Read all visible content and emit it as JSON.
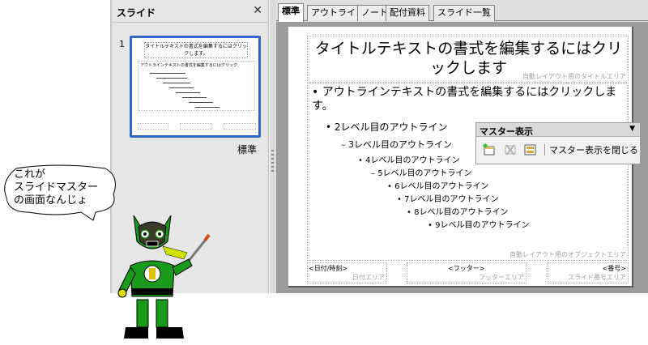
{
  "slides_pane": {
    "title": "スライド",
    "close_icon": "close-icon",
    "thumbnail_number": "1",
    "layout_name": "標準",
    "thumb_title": "タイトルテキストの書式を編集するにはクリックします。",
    "thumb_line": "アウトラインテキストの書式を編集するにはクリック"
  },
  "tabs": [
    "標準",
    "アウトライン",
    "ノート",
    "配付資料",
    "スライド一覧"
  ],
  "slide": {
    "title": "タイトルテキストの書式を編集するにはクリックします",
    "title_area_label": "自動レイアウト用のタイトルエリア",
    "outline": [
      "アウトラインテキストの書式を編集するにはクリックします。",
      "2レベル目のアウトライン",
      "3レベル目のアウトライン",
      "4レベル目のアウトライン",
      "5レベル目のアウトライン",
      "6レベル目のアウトライン",
      "7レベル目のアウトライン",
      "8レベル目のアウトライン",
      "9レベル目のアウトライン"
    ],
    "bullets": [
      "•",
      "•",
      "–",
      "•",
      "–",
      "•",
      "•",
      "•",
      "•"
    ],
    "object_area_label": "自動レイアウト用のオブジェクトエリア",
    "date_field": "<日付/時刻>",
    "date_area_label": "日付エリア",
    "footer_field": "<フッター>",
    "footer_area_label": "フッターエリア",
    "number_field": "<番号>",
    "number_area_label": "スライド番号エリア"
  },
  "master_toolbar": {
    "title": "マスター表示",
    "caret": "▼",
    "close_label": "マスター表示を閉じる",
    "icons": [
      "new-master-icon",
      "delete-master-icon",
      "master-layout-icon"
    ]
  },
  "bubble": {
    "text": "これが\nスライドマスター\nの画面なんじょ"
  },
  "colors": {
    "selection_border": "#3165c6",
    "character_green": "#1a9a1a"
  }
}
